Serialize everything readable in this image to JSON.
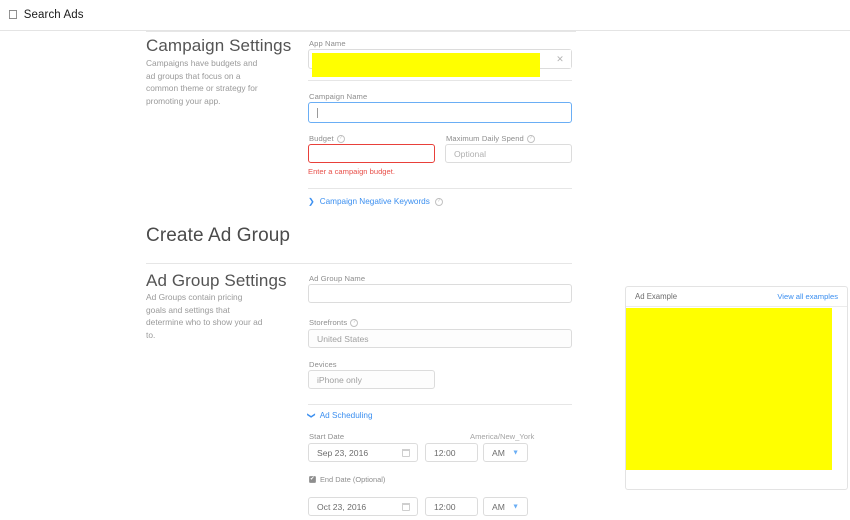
{
  "header": {
    "apple_logo": "apple-logo-icon",
    "brand": "Search Ads"
  },
  "campaign_settings": {
    "title": "Campaign Settings",
    "description": "Campaigns have budgets and ad groups that focus on a common theme or strategy for promoting your app.",
    "fields": {
      "app_name": {
        "label": "App Name",
        "value": "",
        "redacted": true,
        "clear_icon": "close-icon"
      },
      "campaign_name": {
        "label": "Campaign Name",
        "value": "",
        "focused": true
      },
      "budget": {
        "label": "Budget",
        "help_icon": "help-icon",
        "value": "",
        "error": true,
        "error_message": "Enter a campaign budget."
      },
      "max_daily_spend": {
        "label": "Maximum Daily Spend",
        "help_icon": "help-icon",
        "placeholder": "Optional",
        "value": ""
      }
    },
    "negative_keywords": {
      "chevron_icon": "chevron-right-icon",
      "label": "Campaign Negative Keywords",
      "help_icon": "help-icon",
      "expanded": false
    }
  },
  "ad_group": {
    "page_title": "Create Ad Group",
    "title": "Ad Group Settings",
    "description": "Ad Groups contain pricing goals and settings that determine who to show your ad to.",
    "fields": {
      "ad_group_name": {
        "label": "Ad Group Name",
        "value": ""
      },
      "storefronts": {
        "label": "Storefronts",
        "help_icon": "help-icon",
        "value": "United States"
      },
      "devices": {
        "label": "Devices",
        "value": "iPhone only"
      }
    },
    "ad_scheduling": {
      "chevron_icon": "chevron-down-icon",
      "label": "Ad Scheduling",
      "expanded": true,
      "timezone": "America/New_York",
      "start": {
        "label": "Start Date",
        "date": "Sep 23, 2016",
        "time": "12:00",
        "meridiem": "AM",
        "calendar_icon": "calendar-icon",
        "select_chevron_icon": "chevron-down-icon"
      },
      "end": {
        "label": "End Date (Optional)",
        "checked": true,
        "date": "Oct 23, 2016",
        "time": "12:00",
        "meridiem": "AM",
        "calendar_icon": "calendar-icon",
        "select_chevron_icon": "chevron-down-icon"
      }
    }
  },
  "ad_example": {
    "title": "Ad Example",
    "link": "View all examples",
    "preview_redacted": true
  },
  "colors": {
    "link": "#3b8ff0",
    "error": "#e8403a",
    "focus": "#6aaef5",
    "redaction": "#ffff00",
    "text": "#6d6d6d",
    "muted": "#9a9a9a"
  }
}
